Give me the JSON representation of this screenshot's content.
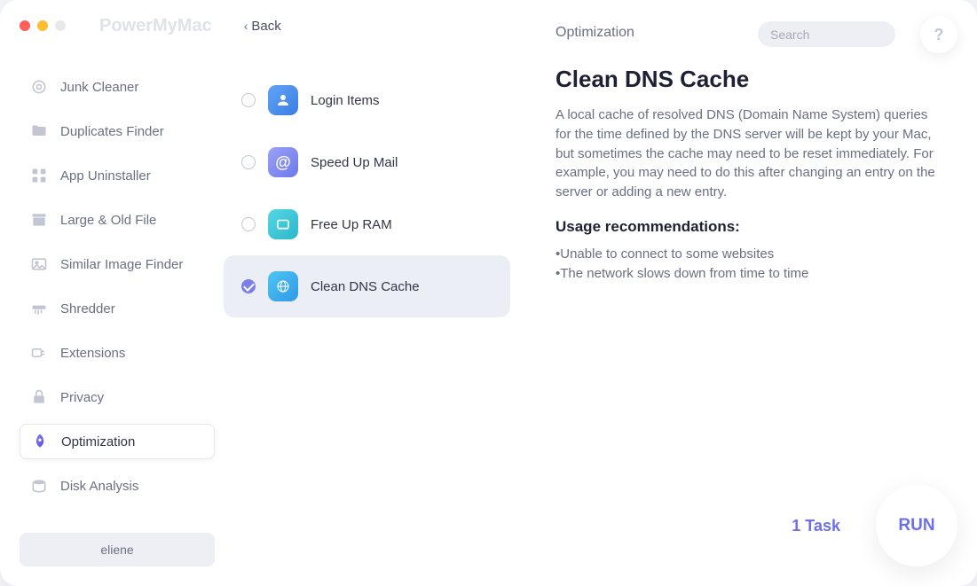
{
  "app_title": "PowerMyMac",
  "back_label": "Back",
  "section_title": "Optimization",
  "search": {
    "placeholder": "Search"
  },
  "help_label": "?",
  "sidebar": {
    "items": [
      {
        "label": "Junk Cleaner",
        "icon": "junk"
      },
      {
        "label": "Duplicates Finder",
        "icon": "duplicates"
      },
      {
        "label": "App Uninstaller",
        "icon": "uninstaller"
      },
      {
        "label": "Large & Old File",
        "icon": "large-old"
      },
      {
        "label": "Similar Image Finder",
        "icon": "similar-image"
      },
      {
        "label": "Shredder",
        "icon": "shredder"
      },
      {
        "label": "Extensions",
        "icon": "extensions"
      },
      {
        "label": "Privacy",
        "icon": "privacy"
      },
      {
        "label": "Optimization",
        "icon": "optimization",
        "active": true
      },
      {
        "label": "Disk Analysis",
        "icon": "disk"
      }
    ]
  },
  "user_name": "eliene",
  "tasks": [
    {
      "label": "Login Items",
      "icon": "login-items",
      "checked": false,
      "color1": "#5fa4f6",
      "color2": "#3b7de4"
    },
    {
      "label": "Speed Up Mail",
      "icon": "speed-mail",
      "checked": false,
      "color1": "#9aa2f5",
      "color2": "#6d78ea"
    },
    {
      "label": "Free Up RAM",
      "icon": "free-ram",
      "checked": false,
      "color1": "#56d7e5",
      "color2": "#2bb7c9"
    },
    {
      "label": "Clean DNS Cache",
      "icon": "clean-dns",
      "checked": true,
      "selected": true,
      "color1": "#4fc6f2",
      "color2": "#2f98e8"
    }
  ],
  "detail": {
    "title": "Clean DNS Cache",
    "description": "A local cache of resolved DNS (Domain Name System) queries for the time defined by the DNS server will be kept by your Mac, but sometimes the cache may need to be reset immediately. For example, you may need to do this after changing an entry on the server or adding a new entry.",
    "rec_heading": "Usage recommendations:",
    "recs": [
      "•Unable to connect to some websites",
      "•The network slows down from time to time"
    ]
  },
  "footer": {
    "task_count": "1 Task",
    "run_label": "RUN"
  }
}
